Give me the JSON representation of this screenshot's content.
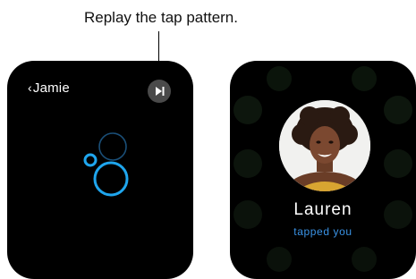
{
  "callout": {
    "text": "Replay the tap pattern."
  },
  "left_screen": {
    "back_chevron": "‹",
    "back_label": "Jamie",
    "replay_icon": "play-skip-icon",
    "accent_color": "#1fa6ee"
  },
  "right_screen": {
    "contact_name": "Lauren",
    "status": "tapped you",
    "status_color": "#3a93e6"
  }
}
